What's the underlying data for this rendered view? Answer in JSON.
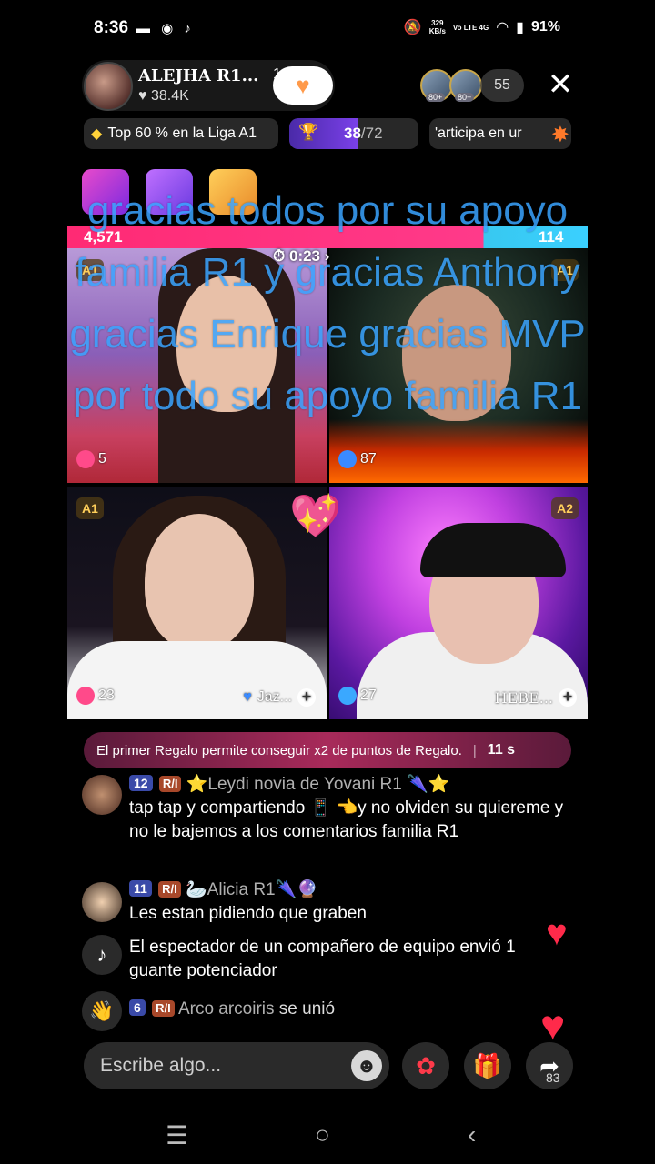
{
  "status": {
    "time": "8:36",
    "net_speed_top": "329",
    "net_speed_bottom": "KB/s",
    "network": "Vo LTE 4G",
    "battery": "91%"
  },
  "host": {
    "name": "ALEJHA R1...",
    "likes": "♥ 38.4K",
    "follow_count": "12"
  },
  "viewers": {
    "badge1": "80+",
    "badge2": "80+",
    "count": "55"
  },
  "league": {
    "text": "Top 60 % en la Liga A1"
  },
  "progress": {
    "current": "38",
    "total": "/72",
    "fraction": 0.53
  },
  "participa": {
    "text": "'articipa en ur"
  },
  "battle": {
    "left_score": "4,571",
    "right_score": "114",
    "timer": "0:23"
  },
  "overlay_text": "gracias todos por su apoyo familia R1 y gracias Anthony gracias Enrique gracias MVP por todo su apoyo familia R1",
  "tiles": {
    "t1_badge": "A1",
    "t1_count": "5",
    "t2_badge": "A1",
    "t2_count": "87",
    "t3_badge": "A1",
    "t3_count": "23",
    "t3_name": "Jaz...",
    "t4_badge": "A2",
    "t4_count": "27",
    "t4_name": "HEBE..."
  },
  "promo": {
    "text": "El primer Regalo permite conseguir x2 de puntos de Regalo.",
    "seconds": "11 s"
  },
  "chat": [
    {
      "level": "12",
      "fan": "R/I",
      "user": "⭐Leydi novia de Yovani R1 🌂⭐",
      "message": "tap tap y compartiendo 📱 👈y no olviden su quiereme y no le bajemos a los comentarios familia R1"
    },
    {
      "level": "11",
      "fan": "R/I",
      "user": "🦢Alicia R1🌂🔮",
      "message": "Les estan pidiendo que graben"
    },
    {
      "message": "El espectador de un compañero de equipo envió 1 guante potenciador"
    },
    {
      "level": "6",
      "fan": "R/I",
      "user": "Arco arcoiris",
      "message": "se unió"
    }
  ],
  "input": {
    "placeholder": "Escribe algo..."
  },
  "share_count": "83"
}
